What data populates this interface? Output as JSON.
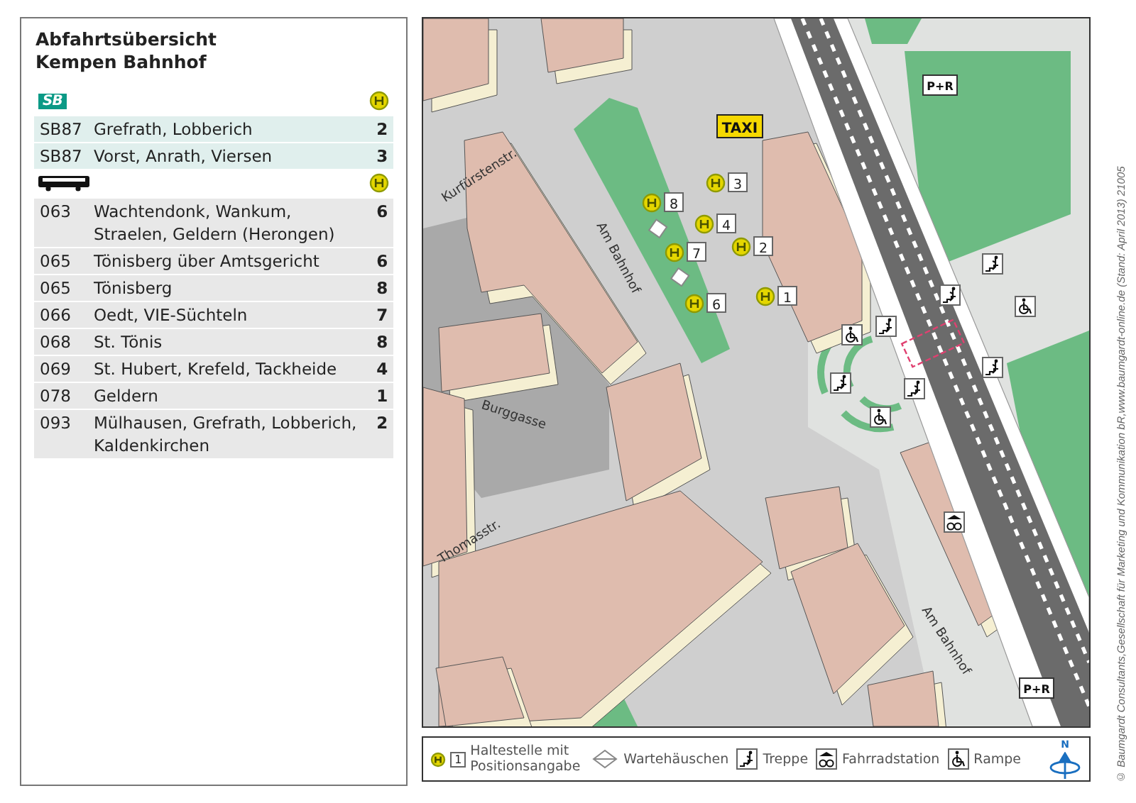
{
  "panel": {
    "title_lines": [
      "Abfahrtsübersicht",
      "Kempen Bahnhof"
    ],
    "sections": [
      {
        "kind": "sb",
        "logo": "SB",
        "rows": [
          {
            "line": "SB87",
            "destination": "Grefrath, Lobberich",
            "stop": "2"
          },
          {
            "line": "SB87",
            "destination": "Vorst, Anrath, Viersen",
            "stop": "3"
          }
        ]
      },
      {
        "kind": "bus",
        "rows": [
          {
            "line": "063",
            "destination": "Wachtendonk, Wankum, Straelen, Geldern (Herongen)",
            "stop": "6"
          },
          {
            "line": "065",
            "destination": "Tönisberg über Amtsgericht",
            "stop": "6"
          },
          {
            "line": "065",
            "destination": "Tönisberg",
            "stop": "8"
          },
          {
            "line": "066",
            "destination": "Oedt, VIE-Süchteln",
            "stop": "7"
          },
          {
            "line": "068",
            "destination": "St. Tönis",
            "stop": "8"
          },
          {
            "line": "069",
            "destination": "St. Hubert, Krefeld, Tackheide",
            "stop": "4"
          },
          {
            "line": "078",
            "destination": "Geldern",
            "stop": "1"
          },
          {
            "line": "093",
            "destination": "Mülhausen, Grefrath, Lobberich, Kaldenkirchen",
            "stop": "2"
          }
        ]
      }
    ]
  },
  "map": {
    "street_labels": [
      "Kurfürstenstr.",
      "Am Bahnhof",
      "Burggasse",
      "Thomasstr.",
      "Am Bahnhof"
    ],
    "taxi": "TAXI",
    "stops": [
      {
        "number": "8"
      },
      {
        "number": "3"
      },
      {
        "number": "4"
      },
      {
        "number": "7"
      },
      {
        "number": "2"
      },
      {
        "number": "6"
      },
      {
        "number": "1"
      }
    ],
    "symbols": [
      {
        "kind": "park-ride",
        "label": "P+R"
      },
      {
        "kind": "stairs"
      },
      {
        "kind": "stairs"
      },
      {
        "kind": "wheelchair"
      },
      {
        "kind": "stairs"
      },
      {
        "kind": "stairs"
      },
      {
        "kind": "stairs"
      },
      {
        "kind": "wheelchair"
      },
      {
        "kind": "stairs"
      },
      {
        "kind": "wheelchair"
      },
      {
        "kind": "bike"
      },
      {
        "kind": "park-ride",
        "label": "P+R"
      }
    ]
  },
  "legend": {
    "items": [
      {
        "kind": "stop",
        "number": "1",
        "label": "Haltestelle mit Positionsangabe"
      },
      {
        "kind": "shelter",
        "label": "Wartehäuschen"
      },
      {
        "kind": "stairs",
        "label": "Treppe"
      },
      {
        "kind": "bike",
        "label": "Fahrradstation"
      },
      {
        "kind": "wheelchair",
        "label": "Rampe"
      }
    ],
    "north": "N"
  },
  "copyright": "© Baumgardt Consultants,Gesellschaft für Marketing und Kommunikation bR,www.baumgardt-online.de (Stand: April 2013) 21005"
}
